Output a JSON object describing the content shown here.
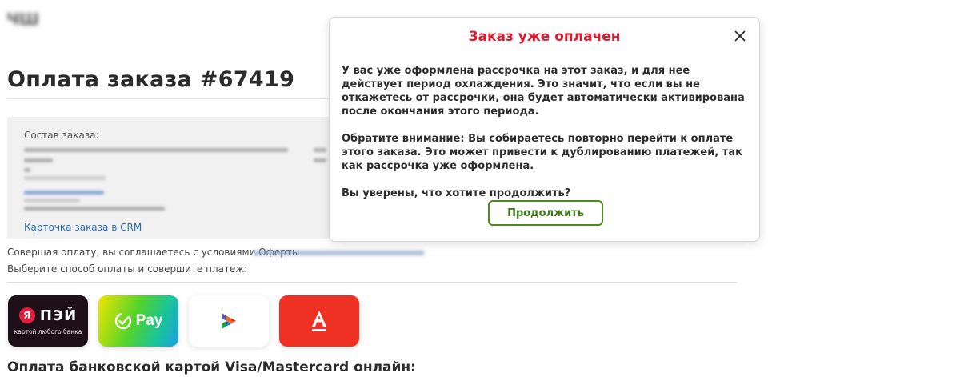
{
  "page": {
    "title": "Оплата заказа #67419"
  },
  "order": {
    "composition_label": "Состав заказа:",
    "crm_link": "Карточка заказа в CRM"
  },
  "consent_text": "Совершая оплату, вы соглашаетесь с условиями Оферты",
  "choose_text": "Выберите способ оплаты и совершите платеж:",
  "payment_methods": {
    "yandex": {
      "badge": "Я",
      "name": "ПЭЙ",
      "subtitle": "картой любого банка",
      "color": "#1f0f17"
    },
    "sber": {
      "name": "Pay",
      "icon": "check-circle-icon"
    },
    "sbp": {
      "icon": "sbp-logo-icon"
    },
    "alfa": {
      "letter": "А",
      "color": "#ef3124"
    }
  },
  "card_payment_heading": "Оплата банковской картой Visa/Mastercard онлайн:",
  "modal": {
    "title": "Заказ уже оплачен",
    "paragraphs": [
      "У вас уже оформлена рассрочка на этот заказ, и для нее действует период охлаждения. Это значит, что если вы не откажетесь от рассрочки, она будет автоматически активирована после окончания этого периода.",
      "Обратите внимание: Вы собираетесь повторно перейти к оплате этого заказа. Это может привести к дублированию платежей, так как рассрочка уже оформлена.",
      "Вы уверены, что хотите продолжить?"
    ],
    "continue_label": "Продолжить",
    "accent_color": "#e0182c",
    "button_color": "#4b8a1f"
  }
}
